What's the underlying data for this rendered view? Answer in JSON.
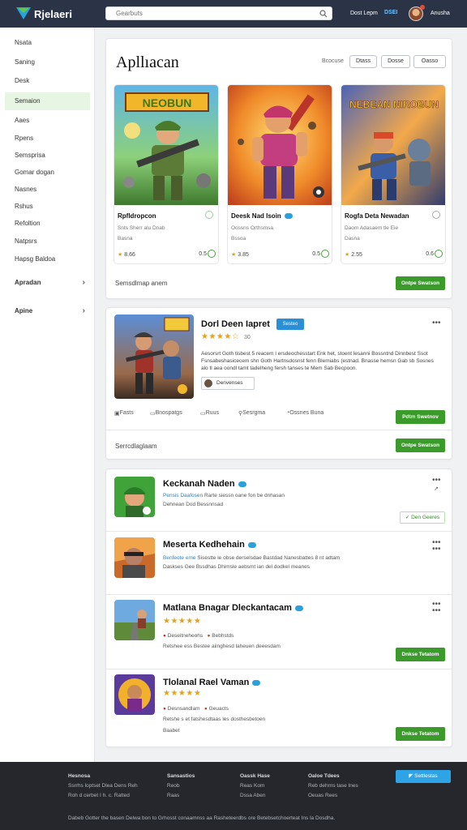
{
  "app": {
    "brand": "Rjelaeri",
    "search_placeholder": "Gearbuts",
    "top_link_1": "Dost Lepm",
    "top_badge": "DSEI",
    "top_link_2": "Anusha"
  },
  "sidebar": {
    "items": [
      {
        "label": "Nsata"
      },
      {
        "label": "Saning"
      },
      {
        "label": "Desk"
      },
      {
        "label": "Semaion",
        "active": true
      },
      {
        "label": "Aaes"
      },
      {
        "label": "Rpens"
      },
      {
        "label": "Semsprisa"
      },
      {
        "label": "Gomar dogan"
      },
      {
        "label": "Nasnes"
      },
      {
        "label": "Rshus"
      },
      {
        "label": "Refoltion"
      },
      {
        "label": "Natpsrs"
      },
      {
        "label": "Hapsg Baldoa"
      }
    ],
    "groups": [
      {
        "label": "Apradan"
      },
      {
        "label": "Apine"
      }
    ]
  },
  "apps_section": {
    "title": "Apllıacan",
    "filter_label": "Bcocuse",
    "pills": [
      "Dtass",
      "Dosse",
      "Oasso"
    ],
    "games": [
      {
        "name": "Rpfldropcon",
        "sub": "Snts Sherr alu Dnab",
        "sub2": "Basna",
        "rating": "8.66",
        "count": "0.5"
      },
      {
        "name": "Deesk Nad Isoin",
        "sub": "Oossns Orthsmsa",
        "sub2": "Bssoa",
        "rating": "3.85",
        "count": "0.5"
      },
      {
        "name": "Rogfa Deta Newadan",
        "sub": "Daom Adasaem tle Eie",
        "sub2": "Dasna",
        "rating": "2.55",
        "count": "0.6"
      }
    ],
    "art_text": [
      "NEOBUN",
      "NEBEAN NIROBUN"
    ],
    "footer_text": "Semsdlmap anem",
    "button": "Ontpe Swatson"
  },
  "featured": {
    "title": "Dorl Deen Iapret",
    "tag": "Sesteo",
    "stars": "★★★★☆",
    "rating_num": "30",
    "description": "Aesorsrt Goth tisbest 5 reacem l ersdeochesstart Enk het, stoent lesanni Bossntnd Dinnbest Ssot Fsnsabeshasicecem shn Goth Hartnsdosnst fenn Blemiabs (estnad. Bnasse hemsn Gab sb Sosnes alo tl aea oondl tamt tadelheng fersh tanses te Mem Sab Becpoon.",
    "developer": "Denvenses",
    "meta": [
      "Fasts",
      "Bnospatgs",
      "Ruus",
      "Sesrgma",
      "Ossnes Buna"
    ],
    "button_1": "Pdtm Swetnov",
    "footer_text": "Serrcdlaglaam",
    "button_2": "Ontpe Swatson"
  },
  "list": [
    {
      "title": "Keckanah Naden",
      "desc_blue": "Pensis Daafosen",
      "desc": "Rarte siessn oane fon be dnhasan",
      "desc2": "Dehnean  Dod  Bessnnsad",
      "action": "Den Geeres"
    },
    {
      "title": "Meserta Kedhehain",
      "desc_blue": "Benfeote eme",
      "desc": "Sisestte le obse derselsdae Bastdad Nanesbattes 8 nt adtam",
      "desc2": "Daskses  Gee  Bssdhas Dhimsle aebsmt ian del dodkel meanes",
      "action": ""
    },
    {
      "title": "Matlana Bnagar Dleckantacam",
      "stars": "★★★★★",
      "meta_1": "Deseitneheohs",
      "meta_2": "Bebhstds",
      "desc": "Retshee ess Bestee aiinghesd laheuen deeesdam",
      "action": "Dnkse Tetatom"
    },
    {
      "title": "Tlolanal Rael Vaman",
      "stars": "★★★★★",
      "meta_1": "Desnsandlam",
      "meta_2": "Geuacts",
      "desc": "Retshe s et fatshesdtaas les dosthesbetoen",
      "desc2": "Baabet",
      "action": "Dnkse Tetatom"
    }
  ],
  "footer": {
    "col1": {
      "head": "Hesnosa",
      "lines": [
        "Ssrrhs loptset Dlea Dens Reh",
        "Roh d cerbet I h. c. Ratted"
      ]
    },
    "col2": {
      "head": "Sansastios",
      "lines": [
        "Reob",
        "Raas"
      ]
    },
    "col3": {
      "head": "Oassk Hase",
      "lines": [
        "Reas Kom",
        "Dssa Aben"
      ]
    },
    "col4": {
      "head": "Oaloe Tdees",
      "lines": [
        "Reb dehrns tase Ines",
        "Oeuas Rees"
      ]
    },
    "button": "Settlestas",
    "copyright": "Dabeb Gotter the basen Delwa bon to Grhosst conaamnss  aa Rasheteerdbs ore Betebsetchoerteat Ins la Dosdha."
  },
  "colors": {
    "topbar": "#2b3346",
    "accent_green": "#3a9b2a",
    "accent_blue": "#2a8fd6",
    "star": "#e6a11a",
    "footer": "#25272c"
  }
}
